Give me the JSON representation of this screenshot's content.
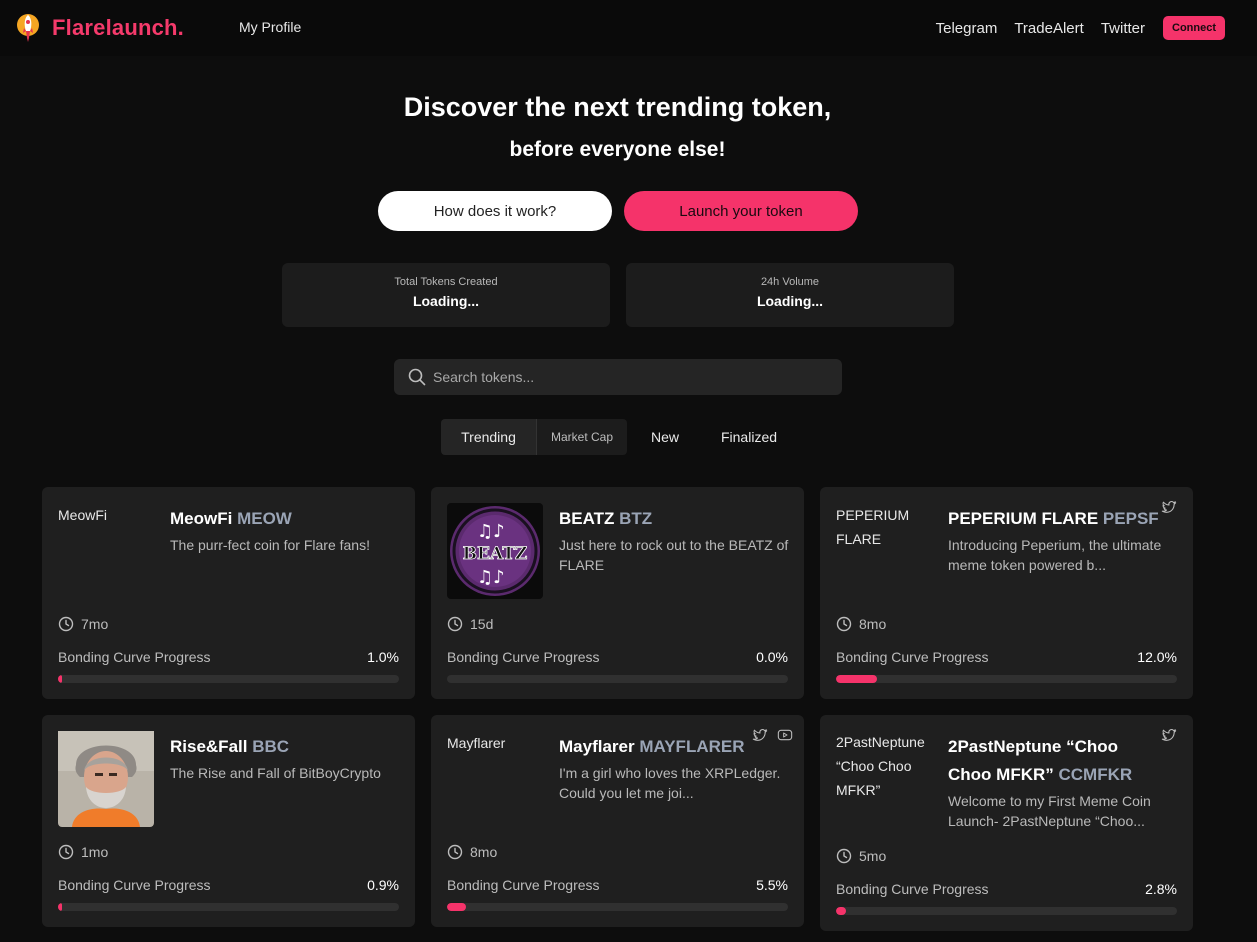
{
  "header": {
    "brand": "Flarelaunch.",
    "my_profile": "My Profile",
    "links": [
      "Telegram",
      "TradeAlert",
      "Twitter"
    ],
    "connect": "Connect"
  },
  "hero": {
    "title": "Discover the next trending token,",
    "subtitle": "before everyone else!",
    "how_button": "How does it work?",
    "launch_button": "Launch your token"
  },
  "stats": [
    {
      "label": "Total Tokens Created",
      "value": "Loading..."
    },
    {
      "label": "24h Volume",
      "value": "Loading..."
    }
  ],
  "search": {
    "placeholder": "Search tokens..."
  },
  "tabs": [
    "Trending",
    "Market Cap",
    "New",
    "Finalized"
  ],
  "colors": {
    "accent": "#f5336a",
    "card": "#1f1f1f",
    "background": "#0d0d0d"
  },
  "tokens": [
    {
      "alt": "MeowFi",
      "name": "MeowFi",
      "ticker": "MEOW",
      "desc": "The purr-fect coin for Flare fans!",
      "age": "7mo",
      "progress_label": "Bonding Curve Progress",
      "progress": "1.0%",
      "progress_fraction": 0.01,
      "socials": []
    },
    {
      "alt": "BEATZ",
      "name": "BEATZ",
      "ticker": "BTZ",
      "desc": "Just here to rock out to the BEATZ of FLARE",
      "image_text": "BEATZ",
      "age": "15d",
      "progress_label": "Bonding Curve Progress",
      "progress": "0.0%",
      "progress_fraction": 0.0,
      "socials": []
    },
    {
      "alt": "PEPERIUM FLARE",
      "name": "PEPERIUM FLARE",
      "ticker": "PEPSF",
      "desc": "Introducing Peperium, the ultimate meme token powered b...",
      "age": "8mo",
      "progress_label": "Bonding Curve Progress",
      "progress": "12.0%",
      "progress_fraction": 0.12,
      "socials": [
        "twitter-icon"
      ]
    },
    {
      "alt": "Rise&Fall",
      "name": "Rise&Fall",
      "ticker": "BBC",
      "desc": "The Rise and Fall of BitBoyCrypto",
      "age": "1mo",
      "progress_label": "Bonding Curve Progress",
      "progress": "0.9%",
      "progress_fraction": 0.009,
      "socials": []
    },
    {
      "alt": "Mayflarer",
      "name": "Mayflarer",
      "ticker": "MAYFLARER",
      "desc": "I'm a girl who loves the XRPLedger. Could you let me joi...",
      "age": "8mo",
      "progress_label": "Bonding Curve Progress",
      "progress": "5.5%",
      "progress_fraction": 0.055,
      "socials": [
        "twitter-icon",
        "youtube-icon"
      ]
    },
    {
      "alt": "2PastNeptune “Choo Choo MFKR”",
      "name": "2PastNeptune “Choo Choo MFKR”",
      "ticker": "CCMFKR",
      "desc": "Welcome to my First Meme Coin Launch- 2PastNeptune “Choo...",
      "age": "5mo",
      "progress_label": "Bonding Curve Progress",
      "progress": "2.8%",
      "progress_fraction": 0.028,
      "socials": [
        "twitter-icon"
      ]
    }
  ]
}
